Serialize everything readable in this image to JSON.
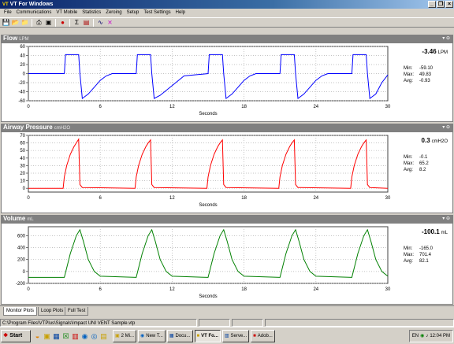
{
  "window": {
    "title": "VT For Windows",
    "minimize": "_",
    "restore": "❐",
    "close": "×"
  },
  "menu": [
    "File",
    "Communications",
    "VT Mobile",
    "Statistics",
    "Zeroing",
    "Setup",
    "Test Settings",
    "Help"
  ],
  "toolbar": [
    "save-icon",
    "open-folder-icon",
    "folder-icon",
    "print-icon",
    "display-icon",
    "record-icon",
    "sigma-icon",
    "grid-icon",
    "waveform-icon",
    "marker-icon"
  ],
  "panels": [
    {
      "title": "Flow",
      "unit": "LPM",
      "current": "-3.46",
      "current_unit": "LPM",
      "min_label": "Min:",
      "min": "-59.10",
      "max_label": "Max:",
      "max": "49.83",
      "avg_label": "Avg:",
      "avg": "-0.93"
    },
    {
      "title": "Airway Pressure",
      "unit": "cmH2O",
      "current": "0.3",
      "current_unit": "cmH2O",
      "min_label": "Min:",
      "min": "-0.1",
      "max_label": "Max:",
      "max": "65.2",
      "avg_label": "Avg:",
      "avg": "8.2"
    },
    {
      "title": "Volume",
      "unit": "mL",
      "current": "-100.1",
      "current_unit": "mL",
      "min_label": "Min:",
      "min": "-165.0",
      "max_label": "Max:",
      "max": "701.4",
      "avg_label": "Avg:",
      "avg": "82.1"
    }
  ],
  "panel_control_label": "▾ ⊖",
  "chart_data": [
    {
      "type": "line",
      "name": "Flow",
      "xlabel": "Seconds",
      "x_ticks": [
        0,
        6,
        12,
        18,
        24,
        30
      ],
      "xlim": [
        0,
        30
      ],
      "ylim": [
        -60,
        60
      ],
      "y_ticks": [
        60,
        40,
        20,
        0,
        -20,
        -40,
        -60
      ],
      "color": "#0000ff",
      "grid": true,
      "series": [
        {
          "x": [
            0,
            3.0,
            3.1,
            4.2,
            4.3,
            4.5,
            5.0,
            5.5,
            6.0,
            6.5,
            7.0,
            8.5,
            9.0,
            9.1,
            10.2,
            10.3,
            10.5,
            11.0,
            13.0,
            15.0,
            15.1,
            16.2,
            16.3,
            16.5,
            17.0,
            17.5,
            18.0,
            18.5,
            19.0,
            21.0,
            21.1,
            22.2,
            22.3,
            22.5,
            23.0,
            23.5,
            24.0,
            24.5,
            25.0,
            27.0,
            27.1,
            28.2,
            28.3,
            28.5,
            29.0,
            29.5,
            30.0
          ],
          "y": [
            0,
            0,
            42,
            42,
            0,
            -55,
            -45,
            -30,
            -15,
            -5,
            0,
            0,
            0,
            42,
            42,
            0,
            -55,
            -48,
            -5,
            0,
            42,
            42,
            0,
            -55,
            -45,
            -30,
            -15,
            -5,
            0,
            0,
            42,
            42,
            0,
            -55,
            -45,
            -30,
            -15,
            -5,
            0,
            0,
            42,
            42,
            0,
            -55,
            -45,
            -20,
            -3
          ]
        }
      ]
    },
    {
      "type": "line",
      "name": "Airway Pressure",
      "xlabel": "Seconds",
      "x_ticks": [
        0,
        6,
        12,
        18,
        24,
        30
      ],
      "xlim": [
        0,
        30
      ],
      "ylim": [
        -5,
        70
      ],
      "y_ticks": [
        70,
        60,
        50,
        40,
        30,
        20,
        10,
        0
      ],
      "color": "#ff0000",
      "grid": true,
      "series": [
        {
          "x": [
            0,
            2.9,
            3.0,
            3.2,
            3.5,
            3.8,
            4.0,
            4.2,
            4.3,
            4.5,
            8.9,
            9.0,
            9.2,
            9.5,
            9.8,
            10.0,
            10.2,
            10.3,
            10.5,
            14.9,
            15.0,
            15.2,
            15.5,
            15.8,
            16.0,
            16.2,
            16.3,
            16.5,
            20.9,
            21.0,
            21.2,
            21.5,
            21.8,
            22.0,
            22.2,
            22.3,
            22.5,
            26.9,
            27.0,
            27.2,
            27.5,
            27.8,
            28.0,
            28.2,
            28.3,
            28.5,
            30.0
          ],
          "y": [
            0,
            0,
            15,
            30,
            45,
            55,
            60,
            65,
            5,
            1,
            0,
            15,
            30,
            45,
            55,
            60,
            64,
            5,
            1,
            0,
            15,
            30,
            45,
            55,
            60,
            64,
            5,
            1,
            0,
            15,
            30,
            45,
            55,
            60,
            64,
            5,
            1,
            0,
            15,
            30,
            45,
            55,
            60,
            64,
            5,
            1,
            0
          ]
        }
      ]
    },
    {
      "type": "line",
      "name": "Volume",
      "xlabel": "Seconds",
      "x_ticks": [
        0,
        6,
        12,
        18,
        24,
        30
      ],
      "xlim": [
        0,
        30
      ],
      "ylim": [
        -200,
        750
      ],
      "y_ticks": [
        600,
        400,
        200,
        0,
        -200
      ],
      "color": "#008000",
      "grid": true,
      "series": [
        {
          "x": [
            0,
            3.0,
            3.5,
            4.0,
            4.3,
            4.6,
            5.0,
            5.5,
            6.0,
            9.0,
            9.5,
            10.0,
            10.3,
            10.6,
            11.0,
            11.5,
            12.0,
            15.0,
            15.5,
            16.0,
            16.3,
            16.6,
            17.0,
            17.5,
            18.0,
            21.0,
            21.5,
            22.0,
            22.3,
            22.6,
            23.0,
            23.5,
            24.0,
            27.0,
            27.5,
            28.0,
            28.3,
            28.6,
            29.0,
            29.5,
            30.0
          ],
          "y": [
            -100,
            -100,
            300,
            600,
            700,
            500,
            200,
            0,
            -80,
            -100,
            300,
            600,
            700,
            500,
            200,
            0,
            -80,
            -100,
            300,
            600,
            700,
            500,
            200,
            0,
            -80,
            -100,
            300,
            600,
            700,
            500,
            200,
            0,
            -80,
            -100,
            300,
            600,
            700,
            500,
            200,
            0,
            -80
          ]
        }
      ]
    }
  ],
  "tabs": [
    "Monitor Plots",
    "Loop Plots",
    "Full Test"
  ],
  "status_path": "C:\\Program Files\\VTPlus\\Signals\\Impact UNI VENT Sample.vtp",
  "taskbar": {
    "start": "Start",
    "tasks": [
      "2 Mi...",
      "New T...",
      "Docu...",
      "VT Fo...",
      "Serve...",
      "Adob..."
    ],
    "clock": "12:04 PM",
    "lang": "EN"
  }
}
